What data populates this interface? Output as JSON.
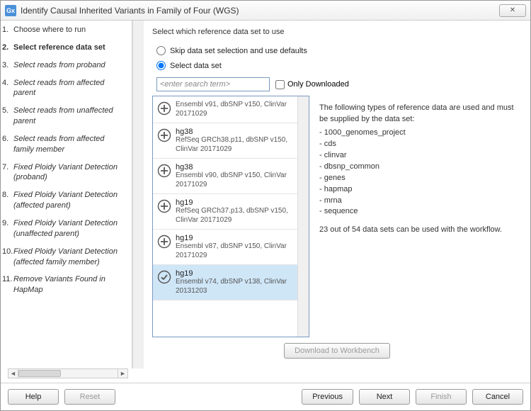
{
  "titlebar": {
    "icon_text": "Gx",
    "title": "Identify Causal Inherited Variants in Family of Four (WGS)"
  },
  "steps": [
    {
      "num": "1",
      "label": "Choose where to run",
      "nostyle": true
    },
    {
      "num": "2",
      "label": "Select reference data set",
      "current": true
    },
    {
      "num": "3",
      "label": "Select reads from proband"
    },
    {
      "num": "4",
      "label": "Select reads from affected parent"
    },
    {
      "num": "5",
      "label": "Select reads from unaffected parent"
    },
    {
      "num": "6",
      "label": "Select reads from affected family member"
    },
    {
      "num": "7",
      "label": "Fixed Ploidy Variant Detection (proband)"
    },
    {
      "num": "8",
      "label": "Fixed Ploidy Variant Detection (affected parent)"
    },
    {
      "num": "9",
      "label": "Fixed Ploidy Variant Detection (unaffected parent)"
    },
    {
      "num": "10",
      "label": "Fixed Ploidy Variant Detection (affected family member)"
    },
    {
      "num": "11",
      "label": "Remove Variants Found in HapMap"
    }
  ],
  "section": {
    "title": "Select which reference data set to use",
    "radio_skip": "Skip data set selection and use defaults",
    "radio_select": "Select data set",
    "search_placeholder": "<enter search term>",
    "only_downloaded": "Only Downloaded"
  },
  "datasets": [
    {
      "assembly": "",
      "desc": "Ensembl v91, dbSNP v150, ClinVar 20171029",
      "icon": "plus"
    },
    {
      "assembly": "hg38",
      "desc": "RefSeq GRCh38.p11, dbSNP v150, ClinVar 20171029",
      "icon": "plus"
    },
    {
      "assembly": "hg38",
      "desc": "Ensembl v90, dbSNP v150, ClinVar 20171029",
      "icon": "plus"
    },
    {
      "assembly": "hg19",
      "desc": "RefSeq GRCh37.p13, dbSNP v150, ClinVar 20171029",
      "icon": "plus"
    },
    {
      "assembly": "hg19",
      "desc": "Ensembl v87, dbSNP v150, ClinVar 20171029",
      "icon": "plus"
    },
    {
      "assembly": "hg19",
      "desc": "Ensembl v74, dbSNP v138, ClinVar 20131203",
      "icon": "check",
      "selected": true
    }
  ],
  "info": {
    "intro": "The following types of reference data are used and must be supplied by the data set:",
    "types": [
      "1000_genomes_project",
      "cds",
      "clinvar",
      "dbsnp_common",
      "genes",
      "hapmap",
      "mrna",
      "sequence"
    ],
    "summary": "23 out of 54 data sets can be used with the workflow."
  },
  "buttons": {
    "download": "Download to Workbench",
    "help": "Help",
    "reset": "Reset",
    "previous": "Previous",
    "next": "Next",
    "finish": "Finish",
    "cancel": "Cancel"
  }
}
